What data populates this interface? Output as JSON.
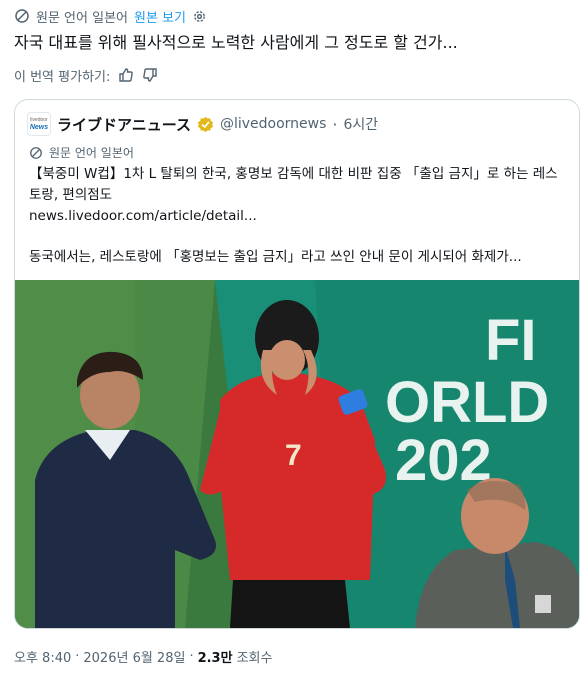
{
  "tweet": {
    "source_language_label": "원문 언어 일본어",
    "show_original_label": "원본 보기",
    "translated_text": "자국 대표를 위해 필사적으로 노력한 사람에게 그 정도로 할 건가...",
    "rate_translation_label": "이 번역 평가하기:"
  },
  "quote": {
    "logo_line1": "livedoor",
    "logo_line2": "News",
    "account_name": "ライブドアニュース",
    "handle": "@livedoornews",
    "time_sep": "·",
    "time": "6시간",
    "source_language_label": "원문 언어 일본어",
    "body_line1": "【북중미 W컵】1차 L 탈퇴의 한국, 홍명보 감독에 대한 비판 집중 「출입 금지」로 하는 레스토랑, 편의점도",
    "link": "news.livedoor.com/article/detail...",
    "body_line2": "동국에서는, 레스토랑에 「홍명보는 출입 금지」라고 쓰인 안내 문이 게시되어 화제가...",
    "photo_text_line1": "FI",
    "photo_text_line2": "ORLD",
    "photo_text_line3": "202",
    "jersey_number": "7"
  },
  "footer": {
    "time": "오후 8:40",
    "sep1": "·",
    "date": "2026년 6월 28일",
    "sep2": "·",
    "views_count": "2.3만",
    "views_label": "조회수"
  },
  "colors": {
    "accent": "#1d9bf0",
    "muted": "#536471",
    "border": "#cfd9de",
    "verified": "#e2b719"
  },
  "icons": [
    "translate-icon",
    "gear-icon",
    "thumbs-up-icon",
    "thumbs-down-icon",
    "verified-badge-icon"
  ]
}
